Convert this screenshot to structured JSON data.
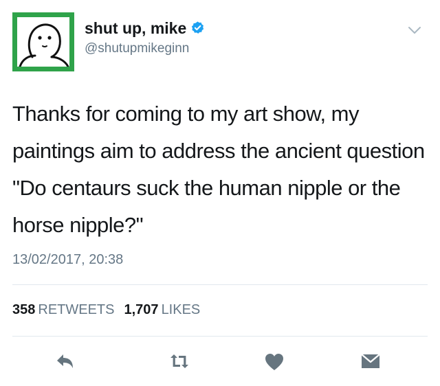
{
  "user": {
    "display_name": "shut up, mike",
    "handle": "@shutupmikeginn",
    "verified": true,
    "avatar_icon": "cartoon-face-avatar"
  },
  "tweet": {
    "text": "Thanks for coming to my art show, my paintings aim to address the ancient question \"Do centaurs suck the human nipple or the horse nipple?\"",
    "timestamp": "13/02/2017, 20:38"
  },
  "stats": {
    "retweets_count": "358",
    "retweets_label": "RETWEETS",
    "likes_count": "1,707",
    "likes_label": "LIKES"
  },
  "actions": [
    {
      "name": "reply",
      "icon": "reply-icon"
    },
    {
      "name": "retweet",
      "icon": "retweet-icon"
    },
    {
      "name": "like",
      "icon": "heart-icon"
    },
    {
      "name": "direct-message",
      "icon": "envelope-icon"
    }
  ],
  "colors": {
    "text_primary": "#14171a",
    "text_secondary": "#657786",
    "verified_blue": "#1da1f2",
    "action_gray": "#66757f",
    "avatar_green": "#2fa34a",
    "divider": "#e1e8ed"
  }
}
